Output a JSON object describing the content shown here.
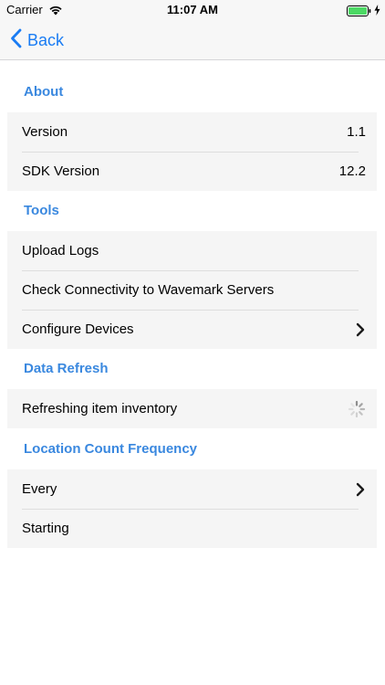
{
  "status_bar": {
    "carrier": "Carrier",
    "time": "11:07 AM",
    "battery_color": "#4cd964"
  },
  "nav": {
    "back_label": "Back",
    "accent": "#1a7cf3"
  },
  "sections": {
    "about": {
      "header": "About",
      "rows": [
        {
          "label": "Version",
          "value": "1.1"
        },
        {
          "label": "SDK Version",
          "value": "12.2"
        }
      ]
    },
    "tools": {
      "header": "Tools",
      "rows": [
        {
          "label": "Upload Logs"
        },
        {
          "label": "Check Connectivity to Wavemark Servers"
        },
        {
          "label": "Configure Devices",
          "icon": "chevron-right-icon"
        }
      ]
    },
    "data_refresh": {
      "header": "Data Refresh",
      "rows": [
        {
          "label": "Refreshing item inventory",
          "icon": "activity-spinner-icon"
        }
      ]
    },
    "location_count": {
      "header": "Location Count Frequency",
      "rows": [
        {
          "label": "Every",
          "icon": "chevron-right-icon"
        },
        {
          "label": "Starting"
        }
      ]
    }
  },
  "colors": {
    "section_header": "#3a88df",
    "group_background": "#f5f5f5"
  }
}
